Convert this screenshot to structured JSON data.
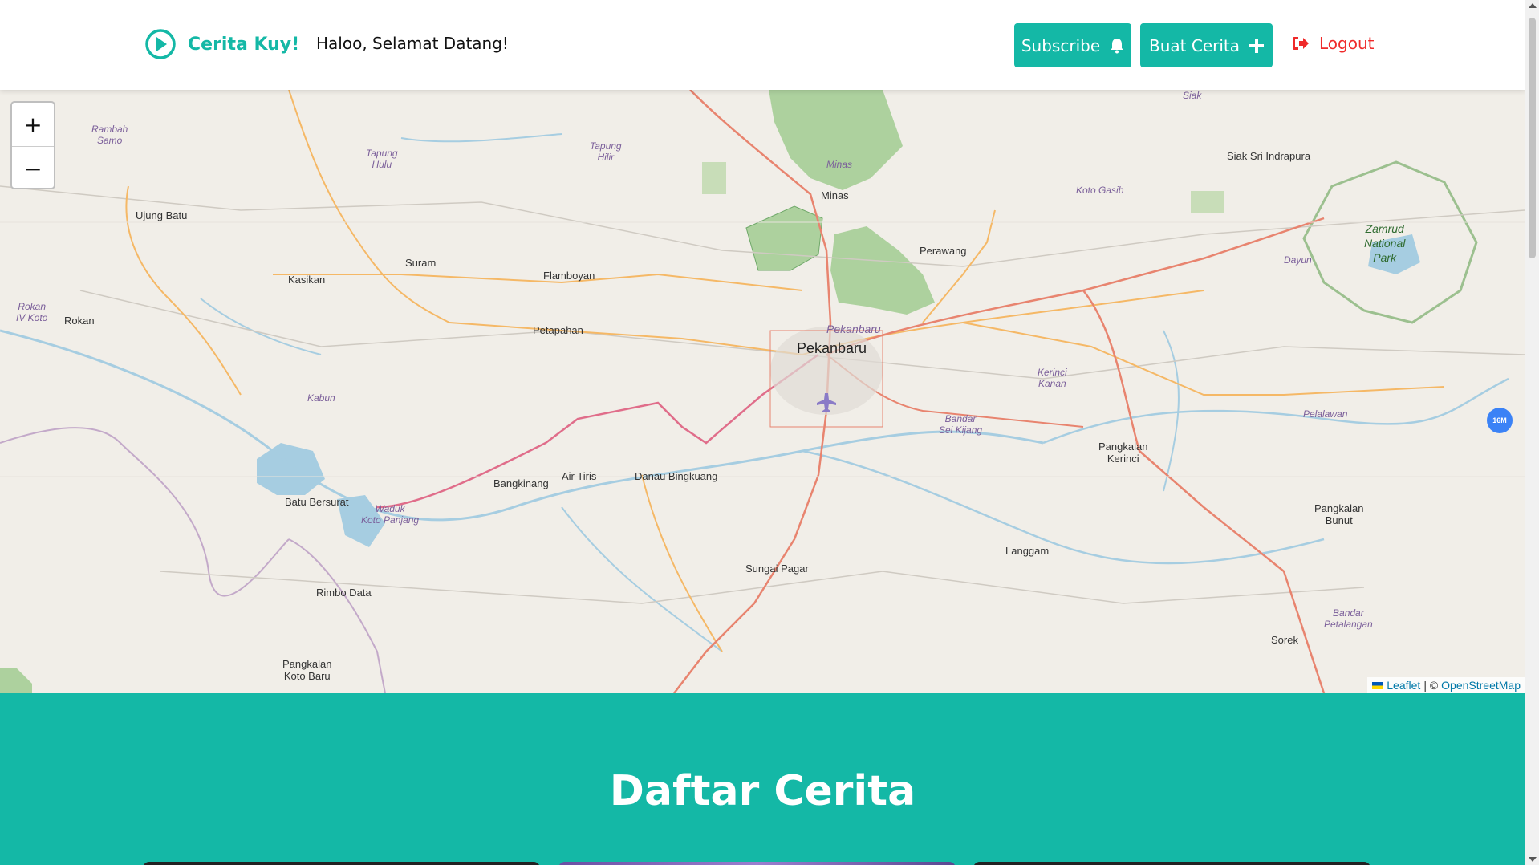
{
  "header": {
    "brand": "Cerita Kuy!",
    "greeting": "Haloo, Selamat Datang!",
    "subscribe_label": "Subscribe",
    "subscribe_icon": "bell-icon",
    "buat_label": "Buat Cerita",
    "buat_icon": "plus-icon",
    "logout_label": "Logout",
    "logout_icon": "sign-out-icon",
    "brand_color": "#14b8a6",
    "logout_color": "#ef2a2a"
  },
  "map": {
    "zoom_in": "+",
    "zoom_out": "−",
    "attribution": {
      "leaflet": "Leaflet",
      "separator": "| ©",
      "osm": "OpenStreetMap"
    },
    "marker_badge": "16M",
    "labels": {
      "pekanbaru": "Pekanbaru",
      "pekanbaru_small": "Pekanbaru",
      "minas": "Minas",
      "minas_it": "Minas",
      "perawang": "Perawang",
      "siak": "Siak Sri Indrapura",
      "koto_gasib": "Koto Gasib",
      "zamrud": "Zamrud\nNational\nPark",
      "dayun": "Dayun",
      "kerinci_kanan": "Kerinci\nKanan",
      "bandar_sei_kijang": "Bandar\nSei Kijang",
      "pelalawan": "Pelalawan",
      "pangkalan_kerinci": "Pangkalan\nKerinci",
      "pangkalan_bunut": "Pangkalan\nBunut",
      "langgam": "Langgam",
      "bandar_petalangan": "Bandar\nPetalangan",
      "sorek": "Sorek",
      "sungai_pagar": "Sungai Pagar",
      "danau_bingkuang": "Danau Bingkuang",
      "air_tiris": "Air Tiris",
      "bangkinang": "Bangkinang",
      "waduk": "Waduk\nKoto Panjang",
      "batu_bersurat": "Batu Bersurat",
      "rimbo_data": "Rimbo Data",
      "pangkalan_koto_baru": "Pangkalan\nKoto Baru",
      "kabun": "Kabun",
      "petapahan": "Petapahan",
      "flamboyan": "Flamboyan",
      "suram": "Suram",
      "kasikan": "Kasikan",
      "rokan": "Rokan",
      "rokan_iv_koto": "Rokan\nIV Koto",
      "ujung_batu": "Ujung Batu",
      "rambah_samo": "Rambah\nSamo",
      "tapung_hulu": "Tapung\nHulu",
      "tapung_hilir": "Tapung\nHilir",
      "siak_top": "Siak"
    }
  },
  "section": {
    "title": "Daftar Cerita"
  }
}
